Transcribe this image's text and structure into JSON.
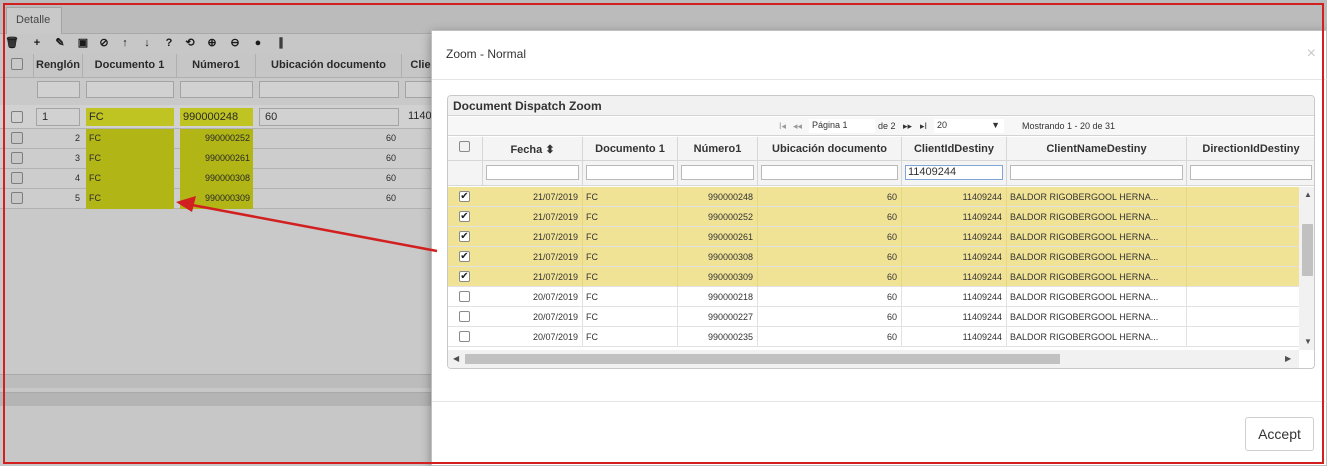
{
  "background": {
    "tab_label": "Detalle",
    "toolbar_icons": [
      "trash-icon",
      "plus-icon",
      "pencil-icon",
      "save-icon",
      "cancel-icon",
      "arrow-up-icon",
      "arrow-down-icon",
      "question-icon",
      "refresh-icon",
      "zoom-in-icon",
      "zoom-out-icon",
      "circle-plus-icon",
      "resize-icon"
    ],
    "toolbar_glyphs": [
      "🗑",
      "+",
      "✎",
      "▣",
      "⊘",
      "↑",
      "↓",
      "?",
      "⟲",
      "⊕",
      "⊖",
      "●",
      "∥"
    ],
    "columns": [
      "Renglón",
      "Documento 1",
      "Número1",
      "Ubicación documento",
      "Clie"
    ],
    "rows": [
      {
        "renglon": "1",
        "documento": "FC",
        "numero": "990000248",
        "ubicacion": "60",
        "cliente": "1140"
      },
      {
        "renglon": "2",
        "documento": "FC",
        "numero": "990000252",
        "ubicacion": "60"
      },
      {
        "renglon": "3",
        "documento": "FC",
        "numero": "990000261",
        "ubicacion": "60"
      },
      {
        "renglon": "4",
        "documento": "FC",
        "numero": "990000308",
        "ubicacion": "60"
      },
      {
        "renglon": "5",
        "documento": "FC",
        "numero": "990000309",
        "ubicacion": "60"
      }
    ]
  },
  "modal": {
    "title": "Zoom - Normal",
    "close_glyph": "×",
    "accept_label": "Accept",
    "panel_title": "Document Dispatch Zoom",
    "pager": {
      "first_glyph": "I◂",
      "prev_glyph": "◂◂",
      "page_label": "Página",
      "page_value": "1",
      "of_label": "de 2",
      "next_glyph": "▸▸",
      "last_glyph": "▸I",
      "page_size": "20",
      "summary": "Mostrando 1 - 20 de 31"
    },
    "columns": [
      "Fecha",
      "Documento 1",
      "Número1",
      "Ubicación documento",
      "ClientIdDestiny",
      "ClientNameDestiny",
      "DirectionIdDestiny"
    ],
    "sort_glyph": "⬍",
    "filters": {
      "client_id": "11409244"
    },
    "rows": [
      {
        "selected": true,
        "fecha": "21/07/2019",
        "documento": "FC",
        "numero": "990000248",
        "ubicacion": "60",
        "client_id": "11409244",
        "client_name": "BALDOR RIGOBERGOOL HERNA..."
      },
      {
        "selected": true,
        "fecha": "21/07/2019",
        "documento": "FC",
        "numero": "990000252",
        "ubicacion": "60",
        "client_id": "11409244",
        "client_name": "BALDOR RIGOBERGOOL HERNA..."
      },
      {
        "selected": true,
        "fecha": "21/07/2019",
        "documento": "FC",
        "numero": "990000261",
        "ubicacion": "60",
        "client_id": "11409244",
        "client_name": "BALDOR RIGOBERGOOL HERNA..."
      },
      {
        "selected": true,
        "fecha": "21/07/2019",
        "documento": "FC",
        "numero": "990000308",
        "ubicacion": "60",
        "client_id": "11409244",
        "client_name": "BALDOR RIGOBERGOOL HERNA..."
      },
      {
        "selected": true,
        "fecha": "21/07/2019",
        "documento": "FC",
        "numero": "990000309",
        "ubicacion": "60",
        "client_id": "11409244",
        "client_name": "BALDOR RIGOBERGOOL HERNA..."
      },
      {
        "selected": false,
        "fecha": "20/07/2019",
        "documento": "FC",
        "numero": "990000218",
        "ubicacion": "60",
        "client_id": "11409244",
        "client_name": "BALDOR RIGOBERGOOL HERNA..."
      },
      {
        "selected": false,
        "fecha": "20/07/2019",
        "documento": "FC",
        "numero": "990000227",
        "ubicacion": "60",
        "client_id": "11409244",
        "client_name": "BALDOR RIGOBERGOOL HERNA..."
      },
      {
        "selected": false,
        "fecha": "20/07/2019",
        "documento": "FC",
        "numero": "990000235",
        "ubicacion": "60",
        "client_id": "11409244",
        "client_name": "BALDOR RIGOBERGOOL HERNA..."
      }
    ],
    "check_glyph": "✔"
  },
  "colors": {
    "selected_row": "#f1e396",
    "highlight_yellow": "#e9ef2a",
    "annotation_red": "#d21f1f"
  }
}
